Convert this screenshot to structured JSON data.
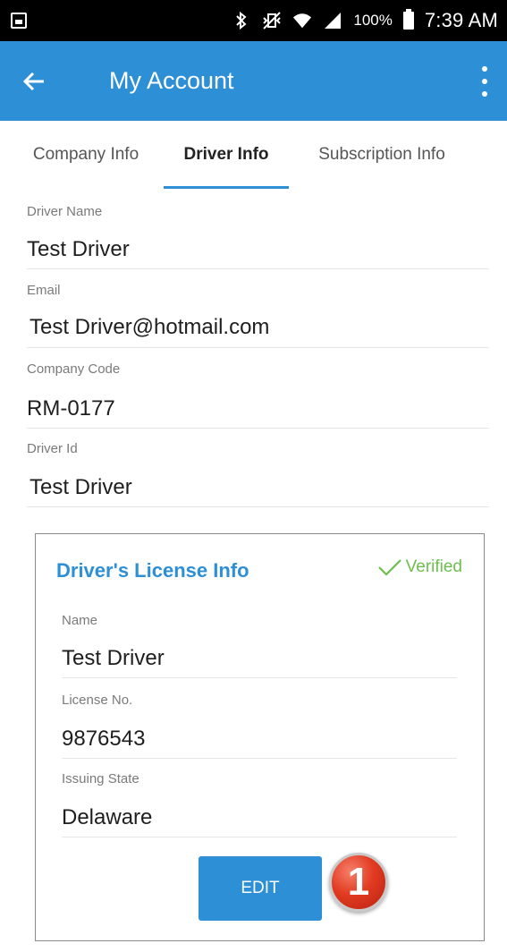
{
  "status_bar": {
    "battery": "100%",
    "time": "7:39 AM",
    "icons": [
      "gallery-icon",
      "bluetooth-icon",
      "vibrate-icon",
      "wifi-icon",
      "signal-icon",
      "battery-icon"
    ]
  },
  "app_bar": {
    "title": "My Account",
    "background": "#2d8fd6"
  },
  "tabs": [
    {
      "label": "Company Info",
      "active": false
    },
    {
      "label": "Driver Info",
      "active": true
    },
    {
      "label": "Subscription Info",
      "active": false
    }
  ],
  "driver_fields": [
    {
      "label": "Driver Name",
      "value": "Test Driver"
    },
    {
      "label": "Email",
      "value": "Test Driver@hotmail.com"
    },
    {
      "label": "Company Code",
      "value": "RM-0177"
    },
    {
      "label": "Driver Id",
      "value": "Test Driver"
    }
  ],
  "license_card": {
    "title": "Driver's License Info",
    "status": "Verified",
    "fields": [
      {
        "label": "Name",
        "value": "Test Driver"
      },
      {
        "label": "License No.",
        "value": "9876543"
      },
      {
        "label": "Issuing State",
        "value": "Delaware"
      }
    ],
    "edit_label": "EDIT",
    "step_badge": "1"
  },
  "colors": {
    "accent": "#2d8fd6",
    "verified": "#6cbf4f",
    "badge": "#e23b22"
  }
}
